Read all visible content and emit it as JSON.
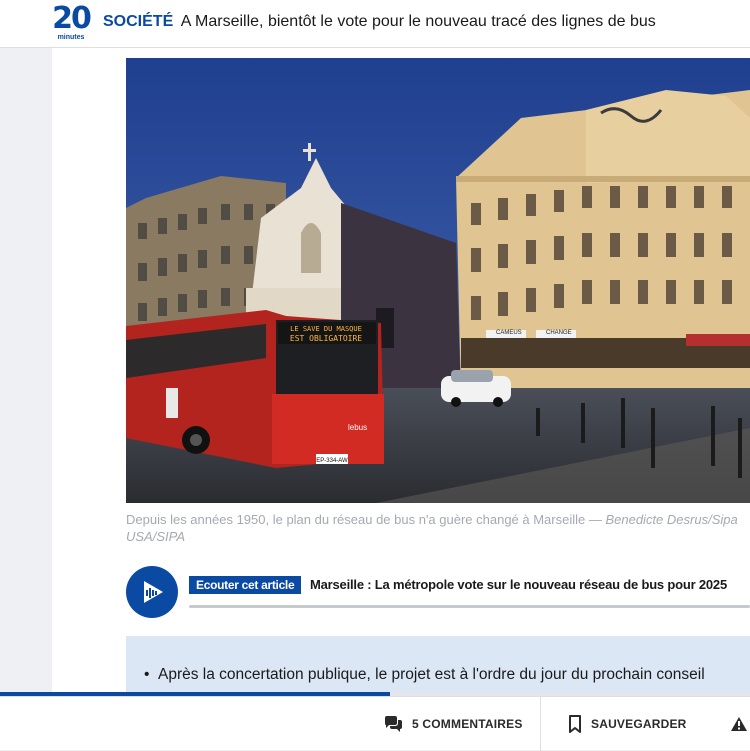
{
  "header": {
    "logo_number": "20",
    "logo_word": "minutes",
    "section": "SOCIÉTÉ",
    "title": "A Marseille, bientôt le vote pour le nouveau tracé des lignes de bus"
  },
  "photo": {
    "bus_display_line1": "LE SAVE DU MASQUE",
    "bus_display_line2": "EST OBLIGATOIRE",
    "bus_brand": "lebus",
    "bus_plate": "EP-334-AW",
    "shop_signs": [
      "CAMEUS",
      "CHANGE"
    ]
  },
  "caption": {
    "text": "Depuis les années 1950, le plan du réseau de bus n'a guère changé à Marseille — ",
    "credit": "Benedicte Desrus/Sipa USA/SIPA"
  },
  "audio": {
    "badge": "Ecouter cet article",
    "title": "Marseille : La métropole vote sur le nouveau réseau de bus pour 2025",
    "progress": 0
  },
  "summary": {
    "bullets": [
      "Après la concertation publique, le projet est à l'ordre du jour du prochain conseil"
    ]
  },
  "reading_progress": 0.52,
  "actions": {
    "comments": "5 COMMENTAIRES",
    "save": "SAUVEGARDER"
  },
  "colors": {
    "brand": "#0b4aa2",
    "summary_bg": "#dce7f6"
  }
}
